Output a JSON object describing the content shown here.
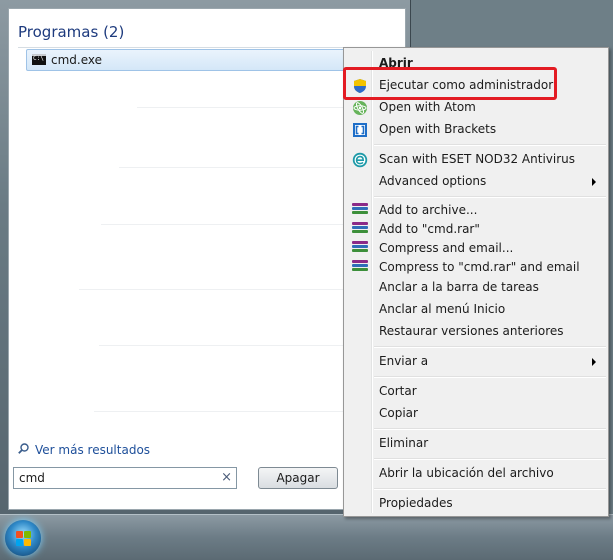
{
  "start_menu": {
    "programs_header": "Programas (2)",
    "result_item": "cmd.exe",
    "more_results": "Ver más resultados",
    "search_value": "cmd",
    "clear_glyph": "×",
    "shutdown_label": "Apagar"
  },
  "context_menu": {
    "items": [
      {
        "label": "Abrir",
        "bold": true
      },
      {
        "label": "Ejecutar como administrador",
        "icon": "uac-shield-icon"
      },
      {
        "label": "Open with Atom",
        "icon": "atom-icon"
      },
      {
        "label": "Open with Brackets",
        "icon": "brackets-icon"
      },
      {
        "label": "Scan with ESET NOD32 Antivirus",
        "icon": "eset-icon"
      },
      {
        "label": "Advanced options",
        "submenu": true
      },
      {
        "label": "Add to archive...",
        "icon": "winrar-icon"
      },
      {
        "label": "Add to \"cmd.rar\"",
        "icon": "winrar-icon"
      },
      {
        "label": "Compress and email...",
        "icon": "winrar-icon"
      },
      {
        "label": "Compress to \"cmd.rar\" and email",
        "icon": "winrar-icon"
      },
      {
        "label": "Anclar a la barra de tareas"
      },
      {
        "label": "Anclar al menú Inicio"
      },
      {
        "label": "Restaurar versiones anteriores"
      },
      {
        "label": "Enviar a",
        "submenu": true
      },
      {
        "label": "Cortar"
      },
      {
        "label": "Copiar"
      },
      {
        "label": "Eliminar"
      },
      {
        "label": "Abrir la ubicación del archivo"
      },
      {
        "label": "Propiedades"
      }
    ]
  },
  "colors": {
    "highlight_border": "#e31b23",
    "link": "#1e4f9a",
    "header": "#1e3b7e"
  }
}
